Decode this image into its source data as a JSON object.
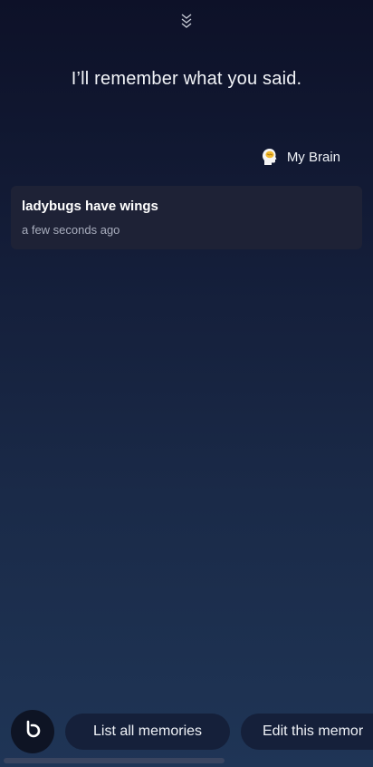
{
  "header": {
    "collapse_icon": "double-chevron-down-icon",
    "headline": "I’ll remember what you said."
  },
  "brain_link": {
    "icon": "brain-head-icon",
    "label": "My Brain"
  },
  "memory": {
    "text": "ladybugs have wings",
    "time": "a few seconds ago"
  },
  "bottom": {
    "bixby_icon": "bixby-b-icon",
    "chips": [
      "List all memories",
      "Edit this memor"
    ]
  },
  "colors": {
    "background_top": "#0d1128",
    "background_bottom": "#1f3556",
    "card": "#1e2236",
    "chip": "#15203a"
  }
}
